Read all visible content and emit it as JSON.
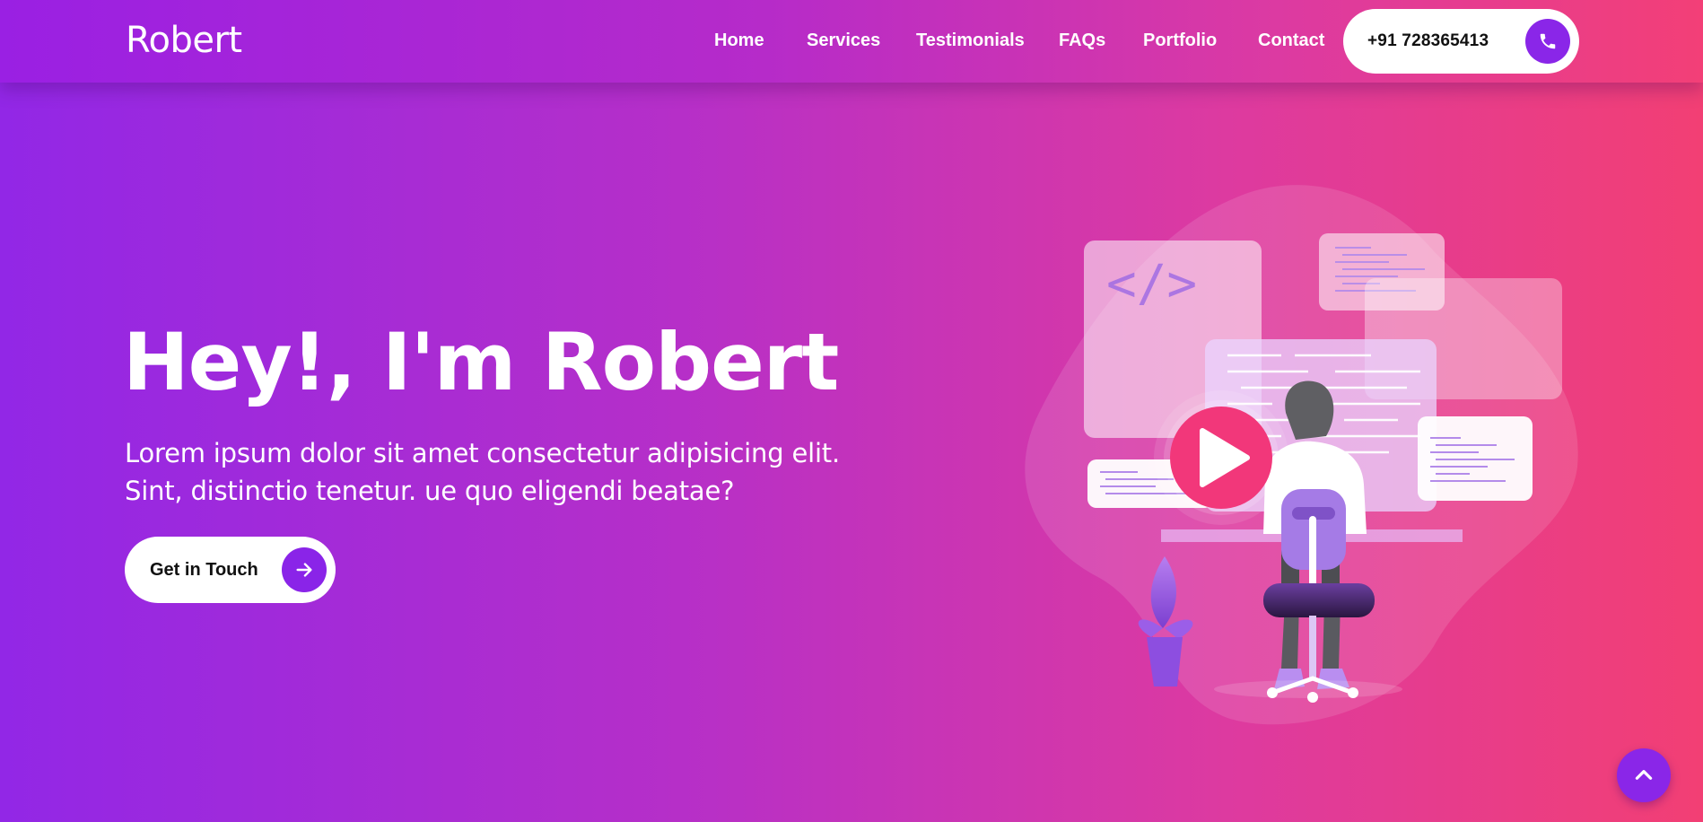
{
  "brand": "Robert",
  "nav": {
    "home": "Home",
    "services": "Services",
    "testimonials": "Testimonials",
    "faqs": "FAQs",
    "portfolio": "Portfolio",
    "contact": "Contact"
  },
  "phone": {
    "number": "+91 728365413",
    "icon": "phone-icon"
  },
  "hero": {
    "title": "Hey!, I'm Robert",
    "text_line1": "Lorem ipsum dolor sit amet consectetur adipisicing elit.",
    "text_line2": "Sint, distinctio tenetur. ue quo eligendi beatae?",
    "cta_label": "Get in Touch",
    "cta_icon": "arrow-right-icon"
  },
  "illustration": {
    "code_symbol": "</>",
    "play_icon": "play-icon"
  },
  "scroll_top_icon": "chevron-up-icon",
  "colors": {
    "gradient_start": "#9227e6",
    "gradient_end": "#f23f74",
    "accent": "#8a26e8",
    "play_button": "#f2377a"
  }
}
